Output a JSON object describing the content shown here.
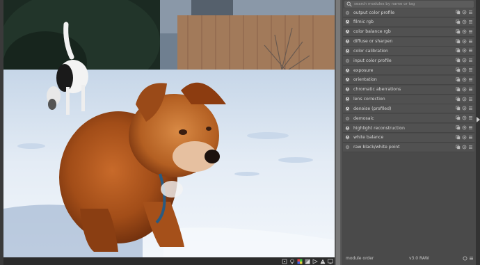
{
  "search": {
    "placeholder": "search modules by name or tag"
  },
  "modules": [
    {
      "label": "output color profile",
      "enabled": false
    },
    {
      "label": "filmic rgb",
      "enabled": true
    },
    {
      "label": "color balance rgb",
      "enabled": true
    },
    {
      "label": "diffuse or sharpen",
      "enabled": true
    },
    {
      "label": "color calibration",
      "enabled": true
    },
    {
      "label": "input color profile",
      "enabled": false
    },
    {
      "label": "exposure",
      "enabled": true
    },
    {
      "label": "orientation",
      "enabled": true
    },
    {
      "label": "chromatic aberrations",
      "enabled": true
    },
    {
      "label": "lens correction",
      "enabled": true
    },
    {
      "label": "denoise (profiled)",
      "enabled": true
    },
    {
      "label": "demosaic",
      "enabled": false
    },
    {
      "label": "highlight reconstruction",
      "enabled": true
    },
    {
      "label": "white balance",
      "enabled": true
    },
    {
      "label": "raw black/white point",
      "enabled": false
    }
  ],
  "footer": {
    "label": "module order",
    "value": "v3.0 RAW"
  },
  "bottom_toolbar": [
    "focus-peaking-icon",
    "bulb-icon",
    "color-assessment-icon",
    "softproof-icon",
    "gamut-check-icon",
    "overexposed-icon",
    "display-profile-icon"
  ],
  "colors": {
    "panel_bg": "#4a4a4a",
    "module_bg": "#515151",
    "text": "#d6d6d6"
  }
}
